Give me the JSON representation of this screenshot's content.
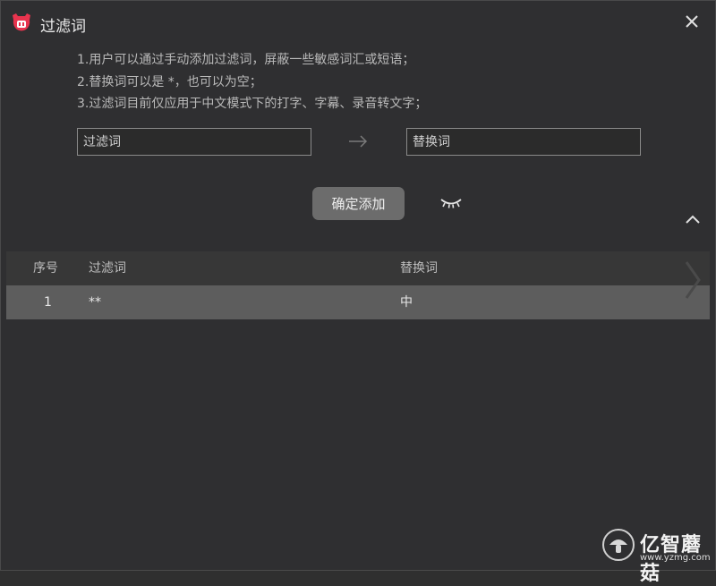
{
  "window": {
    "title": "过滤词",
    "close_icon": "close-icon",
    "logo_color": "#e8344e"
  },
  "instructions": [
    "1.用户可以通过手动添加过滤词，屏蔽一些敏感词汇或短语；",
    "2.替换词可以是 *，也可以为空；",
    "3.过滤词目前仅应用于中文模式下的打字、字幕、录音转文字；"
  ],
  "form": {
    "filter_placeholder": "过滤词",
    "replace_placeholder": "替换词",
    "add_label": "确定添加"
  },
  "table": {
    "headers": {
      "index": "序号",
      "filter": "过滤词",
      "replace": "替换词"
    },
    "rows": [
      {
        "index": "1",
        "filter": "**",
        "replace": "中"
      }
    ]
  },
  "watermark": {
    "text": "亿智蘑菇",
    "url": "www.yzmg.com"
  }
}
